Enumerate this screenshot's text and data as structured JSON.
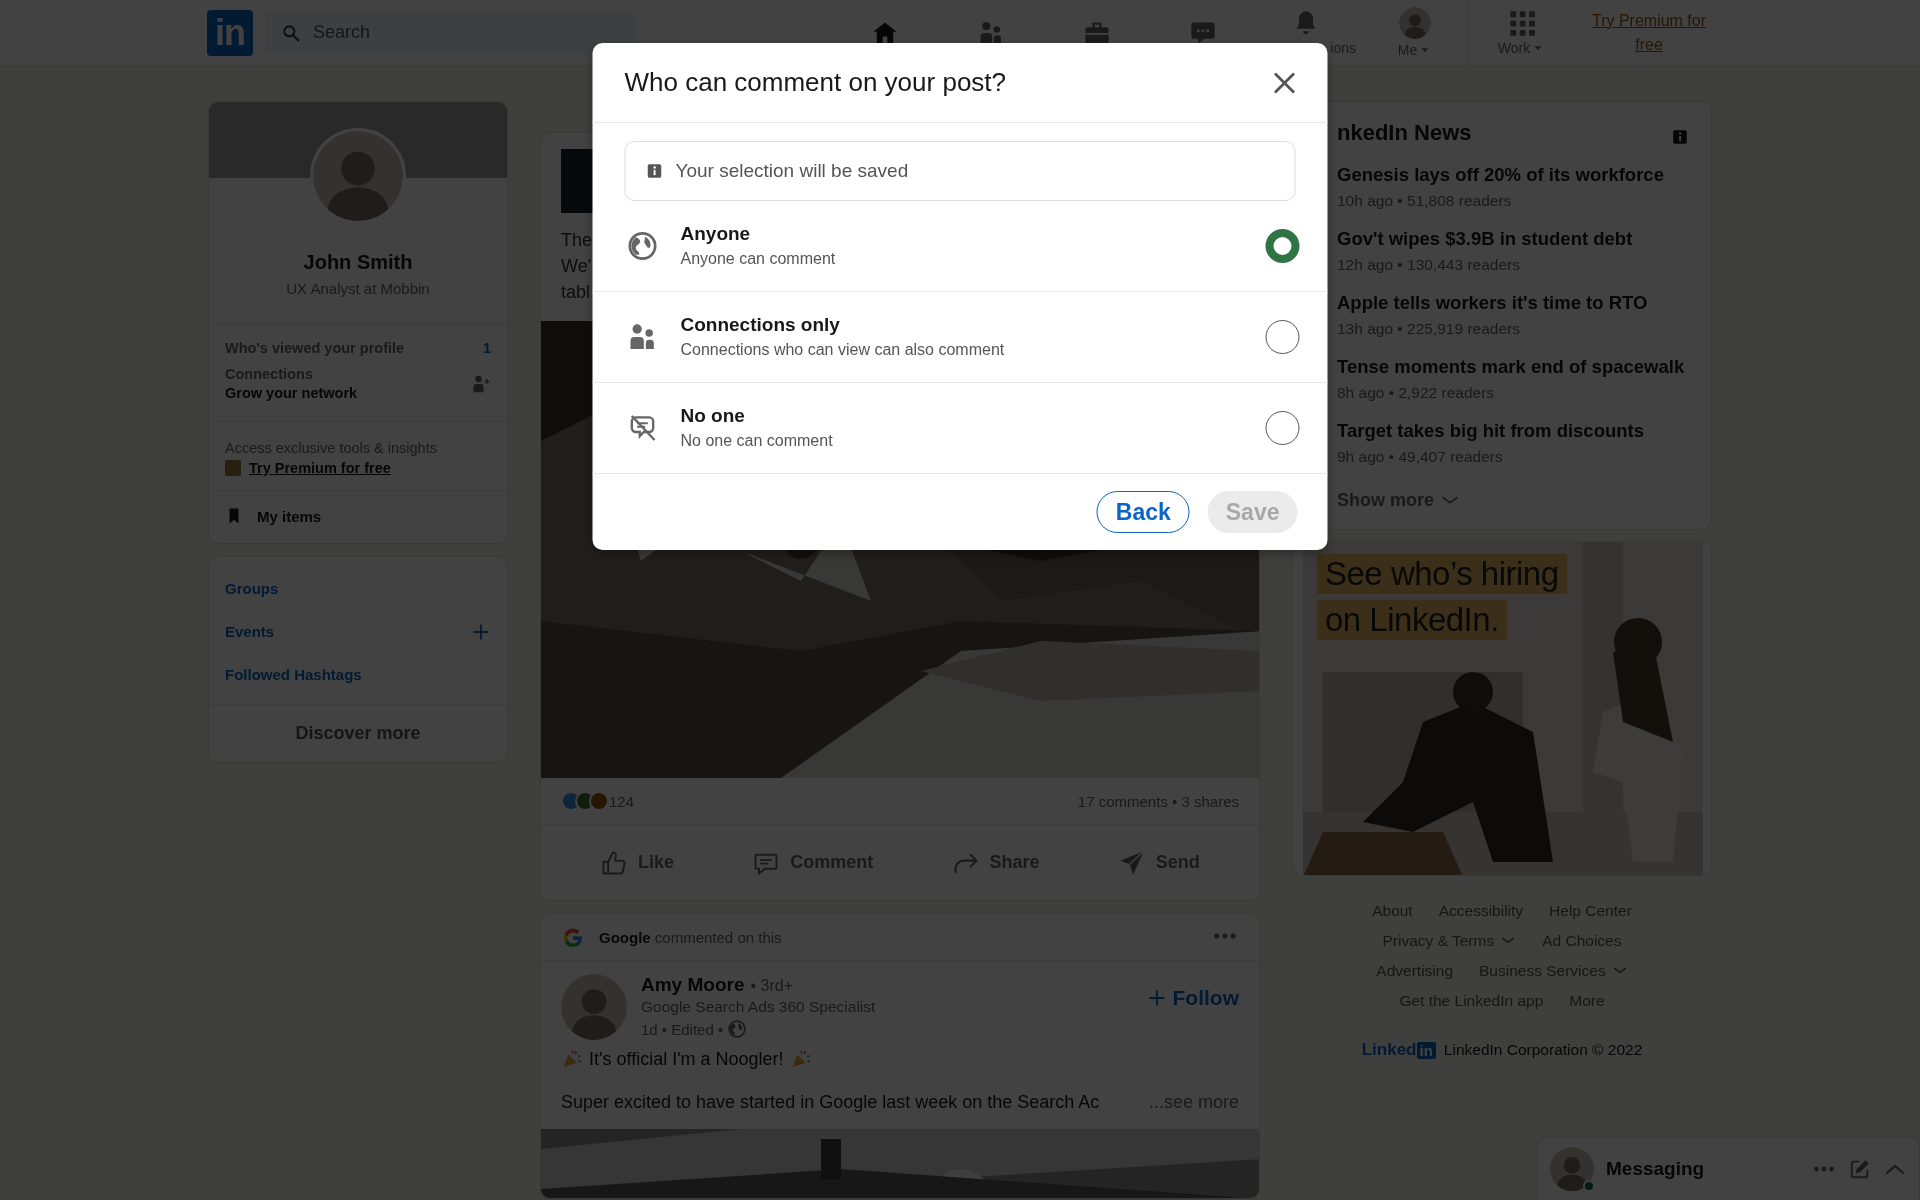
{
  "nav": {
    "logo": "in",
    "search": {
      "placeholder": "Search"
    },
    "items": [
      {
        "kind": "home",
        "selected": true
      },
      {
        "kind": "people",
        "selected": false
      },
      {
        "kind": "briefcase",
        "selected": false
      },
      {
        "kind": "chat",
        "selected": false
      },
      {
        "kind": "bell",
        "label": "ions",
        "selected": false,
        "caret": false
      },
      {
        "kind": "me",
        "label": "Me",
        "selected": false,
        "caret": true
      },
      {
        "kind": "grid",
        "label": "Work",
        "selected": false,
        "caret": true
      }
    ],
    "premium_link": "Try Premium for free"
  },
  "profile": {
    "name": "John Smith",
    "headline": "UX Analyst at Mobbin",
    "viewers": {
      "label": "Who's viewed your profile",
      "count": "1"
    },
    "connections": {
      "label": "Connections",
      "action": "Grow your network"
    },
    "premium": {
      "text": "Access exclusive tools & insights",
      "link": "Try Premium for free"
    },
    "my_items": "My items"
  },
  "shortcuts": {
    "links": [
      {
        "label": "Groups",
        "addable": false
      },
      {
        "label": "Events",
        "addable": true
      },
      {
        "label": "Followed Hashtags",
        "addable": false
      }
    ],
    "discover": "Discover more"
  },
  "post": {
    "text_lines": [
      "The",
      "We'",
      "tabl"
    ],
    "reactions_count": "124",
    "stats": "17 comments • 3 shares",
    "actions": [
      {
        "kind": "like",
        "label": "Like"
      },
      {
        "kind": "comment",
        "label": "Comment"
      },
      {
        "kind": "share",
        "label": "Share"
      },
      {
        "kind": "send",
        "label": "Send"
      }
    ]
  },
  "post2": {
    "context_author": "Google",
    "context_text": "commented on this",
    "author": "Amy Moore",
    "degree": "• 3rd+",
    "headline": "Google Search Ads 360 Specialist",
    "meta": "1d • Edited •",
    "follow": "Follow",
    "line1": "It's official I'm a Noogler!",
    "line2": "Super excited to have started in Google last week on the Search Ac",
    "see_more": "...see more"
  },
  "news": {
    "title": "nkedIn News",
    "items": [
      {
        "headline": "Genesis lays off 20% of its workforce",
        "meta": "10h ago • 51,808 readers"
      },
      {
        "headline": "Gov't wipes $3.9B in student debt",
        "meta": "12h ago • 130,443 readers"
      },
      {
        "headline": "Apple tells workers it's time to RTO",
        "meta": "13h ago • 225,919 readers"
      },
      {
        "headline": "Tense moments mark end of spacewalk",
        "meta": "8h ago • 2,922 readers"
      },
      {
        "headline": "Target takes big hit from discounts",
        "meta": "9h ago • 49,407 readers"
      }
    ],
    "show_more": "Show more"
  },
  "ad": {
    "kind": "picture",
    "headline_lines": [
      "See who’s hiring",
      "on LinkedIn."
    ]
  },
  "footer": {
    "rows": [
      [
        {
          "label": "About",
          "dropdown": false
        },
        {
          "label": "Accessibility",
          "dropdown": false
        },
        {
          "label": "Help Center",
          "dropdown": false
        }
      ],
      [
        {
          "label": "Privacy & Terms",
          "dropdown": true
        },
        {
          "label": "Ad Choices",
          "dropdown": false
        }
      ],
      [
        {
          "label": "Advertising",
          "dropdown": false
        },
        {
          "label": "Business Services",
          "dropdown": true
        }
      ],
      [
        {
          "label": "Get the LinkedIn app",
          "dropdown": false
        },
        {
          "label": "More",
          "dropdown": false
        }
      ]
    ],
    "logo_word": "Linked",
    "logo_box": "in",
    "copyright": "LinkedIn Corporation © 2022"
  },
  "messaging": {
    "title": "Messaging",
    "online": true
  },
  "dialog": {
    "title": "Who can comment on your post?",
    "notice": "Your selection will be saved",
    "options": [
      {
        "kind": "globe",
        "title": "Anyone",
        "description": "Anyone can comment",
        "selected": true
      },
      {
        "kind": "people",
        "title": "Connections only",
        "description": "Connections who can view can also comment",
        "selected": false
      },
      {
        "kind": "nocomment",
        "title": "No one",
        "description": "No one can comment",
        "selected": false
      }
    ],
    "buttons": [
      {
        "label": "Back",
        "kind": "secondary",
        "disabled": false
      },
      {
        "label": "Save",
        "kind": "primary",
        "disabled": true
      }
    ]
  }
}
